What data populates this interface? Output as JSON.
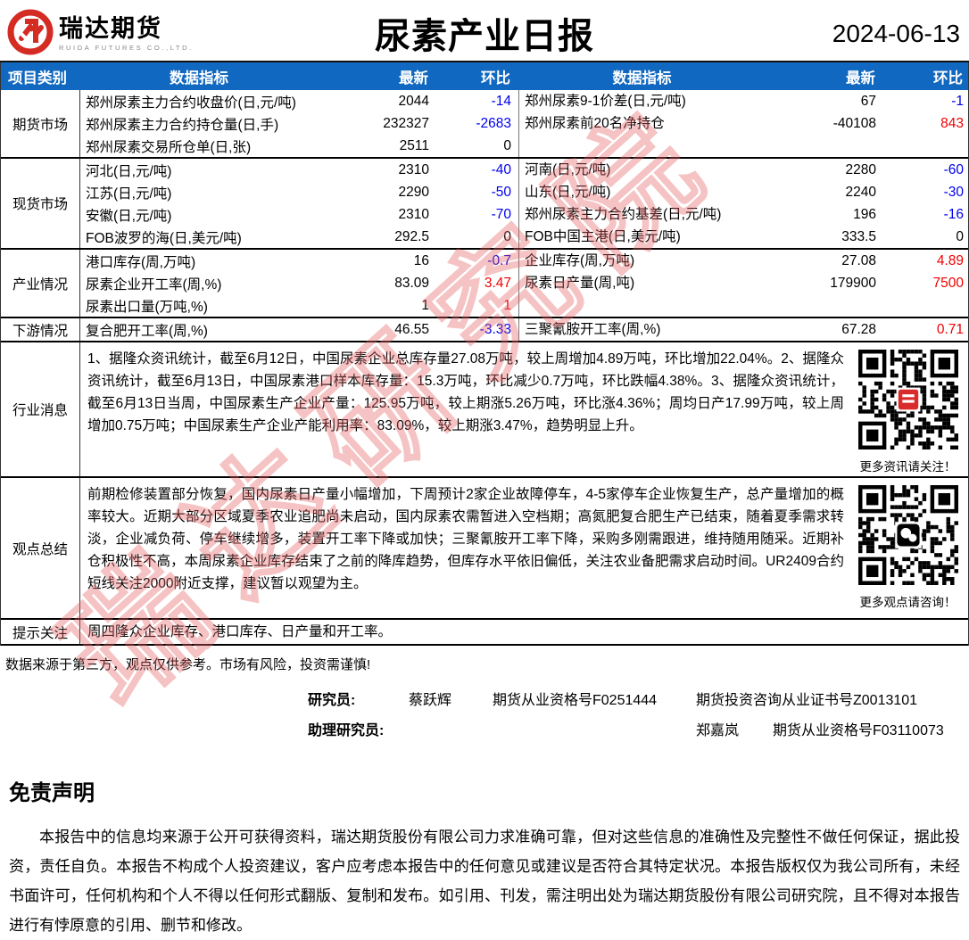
{
  "header": {
    "logo_text": "瑞达期货",
    "logo_sub": "RUIDA FUTURES CO.,LTD.",
    "title": "尿素产业日报",
    "date": "2024-06-13"
  },
  "colors": {
    "header_blue": "#1168c0",
    "change_up_red": "#f00000",
    "change_down_blue": "#0000ee",
    "logo_red": "#d42b23",
    "watermark_pink": "rgba(228,96,96,0.38)"
  },
  "table": {
    "columns": [
      "项目类别",
      "数据指标",
      "最新",
      "环比",
      "数据指标",
      "最新",
      "环比"
    ],
    "sections": [
      {
        "category": "期货市场",
        "rows": [
          {
            "l_ind": "郑州尿素主力合约收盘价(日,元/吨)",
            "l_val": "2044",
            "l_chg": "-14",
            "l_c": "blue",
            "r_ind": "郑州尿素9-1价差(日,元/吨)",
            "r_val": "67",
            "r_chg": "-1",
            "r_c": "blue"
          },
          {
            "l_ind": "郑州尿素主力合约持仓量(日,手)",
            "l_val": "232327",
            "l_chg": "-2683",
            "l_c": "blue",
            "r_ind": "郑州尿素前20名净持仓",
            "r_val": "-40108",
            "r_chg": "843",
            "r_c": "red"
          },
          {
            "l_ind": "郑州尿素交易所仓单(日,张)",
            "l_val": "2511",
            "l_chg": "0",
            "l_c": "black",
            "r_ind": "",
            "r_val": "",
            "r_chg": "",
            "r_c": "black"
          }
        ]
      },
      {
        "category": "现货市场",
        "rows": [
          {
            "l_ind": "河北(日,元/吨)",
            "l_val": "2310",
            "l_chg": "-40",
            "l_c": "blue",
            "r_ind": "河南(日,元/吨)",
            "r_val": "2280",
            "r_chg": "-60",
            "r_c": "blue"
          },
          {
            "l_ind": "江苏(日,元/吨)",
            "l_val": "2290",
            "l_chg": "-50",
            "l_c": "blue",
            "r_ind": "山东(日,元/吨)",
            "r_val": "2240",
            "r_chg": "-30",
            "r_c": "blue"
          },
          {
            "l_ind": "安徽(日,元/吨)",
            "l_val": "2310",
            "l_chg": "-70",
            "l_c": "blue",
            "r_ind": "郑州尿素主力合约基差(日,元/吨)",
            "r_val": "196",
            "r_chg": "-16",
            "r_c": "blue"
          },
          {
            "l_ind": "FOB波罗的海(日,美元/吨)",
            "l_val": "292.5",
            "l_chg": "0",
            "l_c": "black",
            "r_ind": "FOB中国主港(日,美元/吨)",
            "r_val": "333.5",
            "r_chg": "0",
            "r_c": "black"
          }
        ]
      },
      {
        "category": "产业情况",
        "rows": [
          {
            "l_ind": "港口库存(周,万吨)",
            "l_val": "16",
            "l_chg": "-0.7",
            "l_c": "blue",
            "r_ind": "企业库存(周,万吨)",
            "r_val": "27.08",
            "r_chg": "4.89",
            "r_c": "red"
          },
          {
            "l_ind": "尿素企业开工率(周,%)",
            "l_val": "83.09",
            "l_chg": "3.47",
            "l_c": "red",
            "r_ind": "尿素日产量(周,吨)",
            "r_val": "179900",
            "r_chg": "7500",
            "r_c": "red"
          },
          {
            "l_ind": "尿素出口量(万吨,%)",
            "l_val": "1",
            "l_chg": "1",
            "l_c": "red",
            "r_ind": "",
            "r_val": "",
            "r_chg": "",
            "r_c": "black"
          }
        ]
      },
      {
        "category": "下游情况",
        "rows": [
          {
            "l_ind": "复合肥开工率(周,%)",
            "l_val": "46.55",
            "l_chg": "-3.33",
            "l_c": "blue",
            "r_ind": "三聚氰胺开工率(周,%)",
            "r_val": "67.28",
            "r_chg": "0.71",
            "r_c": "red"
          }
        ]
      }
    ],
    "news": {
      "category": "行业消息",
      "text": "1、据隆众资讯统计，截至6月12日，中国尿素企业总库存量27.08万吨，较上周增加4.89万吨，环比增加22.04%。2、据隆众资讯统计，截至6月13日，中国尿素港口样本库存量：15.3万吨，环比减少0.7万吨，环比跌幅4.38%。3、据隆众资讯统计，截至6月13日当周，中国尿素生产企业产量：125.95万吨，较上期涨5.26万吨，环比涨4.36%；周均日产17.99万吨，较上周增加0.75万吨；中国尿素生产企业产能利用率：83.09%，较上期涨3.47%，趋势明显上升。",
      "qr_caption": "更多资讯请关注！"
    },
    "summary": {
      "category": "观点总结",
      "text": "前期检修装置部分恢复，国内尿素日产量小幅增加，下周预计2家企业故障停车，4-5家停车企业恢复生产，总产量增加的概率较大。近期大部分区域夏季农业追肥尚未启动，国内尿素农需暂进入空档期；高氮肥复合肥生产已结束，随着夏季需求转淡，企业减负荷、停车继续增多，装置开工率下降或加快；三聚氰胺开工率下降，采购多刚需跟进，维持随用随采。近期补仓积极性不高，本周尿素企业库存结束了之前的降库趋势，但库存水平依旧偏低，关注农业备肥需求启动时间。UR2409合约短线关注2000附近支撑，建议暂以观望为主。",
      "qr_caption": "更多观点请咨询！"
    },
    "alert": {
      "category": "提示关注",
      "text": "周四隆众企业库存、港口库存、日产量和开工率。"
    }
  },
  "footer": {
    "source_note": "数据来源于第三方，观点仅供参考。市场有风险，投资需谨慎!",
    "researcher_label": "研究员:",
    "researcher_name": "蔡跃辉",
    "researcher_cert": "期货从业资格号F0251444",
    "researcher_cert2": "期货投资咨询从业证书号Z0013101",
    "assistant_label": "助理研究员:",
    "assistant_name": "郑嘉岚",
    "assistant_cert": "期货从业资格号F03110073"
  },
  "disclaimer": {
    "heading": "免责声明",
    "body": "本报告中的信息均来源于公开可获得资料，瑞达期货股份有限公司力求准确可靠，但对这些信息的准确性及完整性不做任何保证，据此投资，责任自负。本报告不构成个人投资建议，客户应考虑本报告中的任何意见或建议是否符合其特定状况。本报告版权仅为我公司所有，未经书面许可，任何机构和个人不得以任何形式翻版、复制和发布。如引用、刊发，需注明出处为瑞达期货股份有限公司研究院，且不得对本报告进行有悖原意的引用、删节和修改。"
  },
  "watermark": "瑞达研究院"
}
